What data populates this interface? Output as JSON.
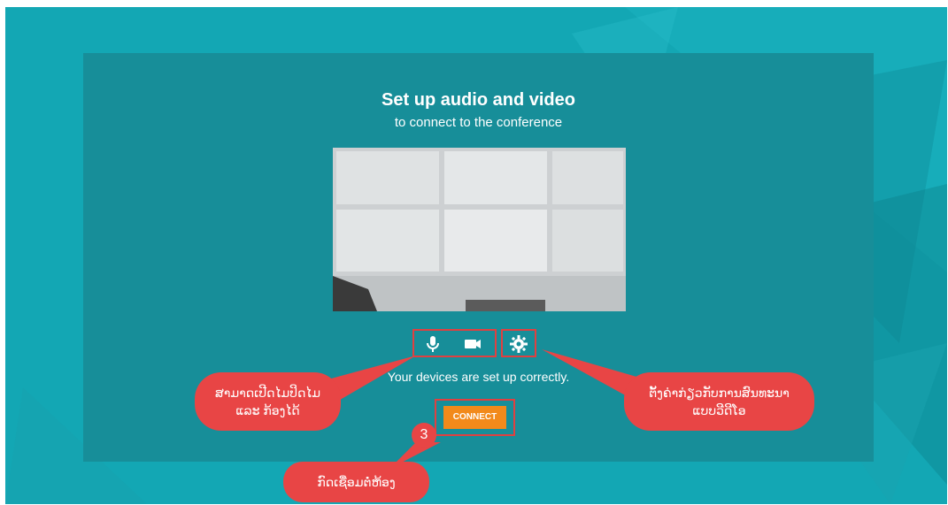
{
  "setup": {
    "title": "Set up audio and video",
    "subtitle": "to connect to the conference",
    "status": "Your devices are set up correctly.",
    "connect_label": "CONNECT"
  },
  "icons": {
    "microphone": "microphone-icon",
    "camera": "camera-icon",
    "settings": "gear-icon"
  },
  "annotations": {
    "mic_camera_note_line1": "ສາມາດເປີດໄມປິດໄມ",
    "mic_camera_note_line2": "ແລະ ກ້ອງໄດ້",
    "settings_note_line1": "ຕັ້ງຄ່າກ່ຽວກັບການສົນທະນາ",
    "settings_note_line2": "ແບບວີດີໂອ",
    "connect_note": "ກົດເຊື່ອມຕໍ່ຫ້ອງ",
    "step_number": "3"
  },
  "colors": {
    "background": "#13a7b4",
    "panel": "#178e99",
    "connect_button": "#f28a1b",
    "callout": "#e84545"
  }
}
